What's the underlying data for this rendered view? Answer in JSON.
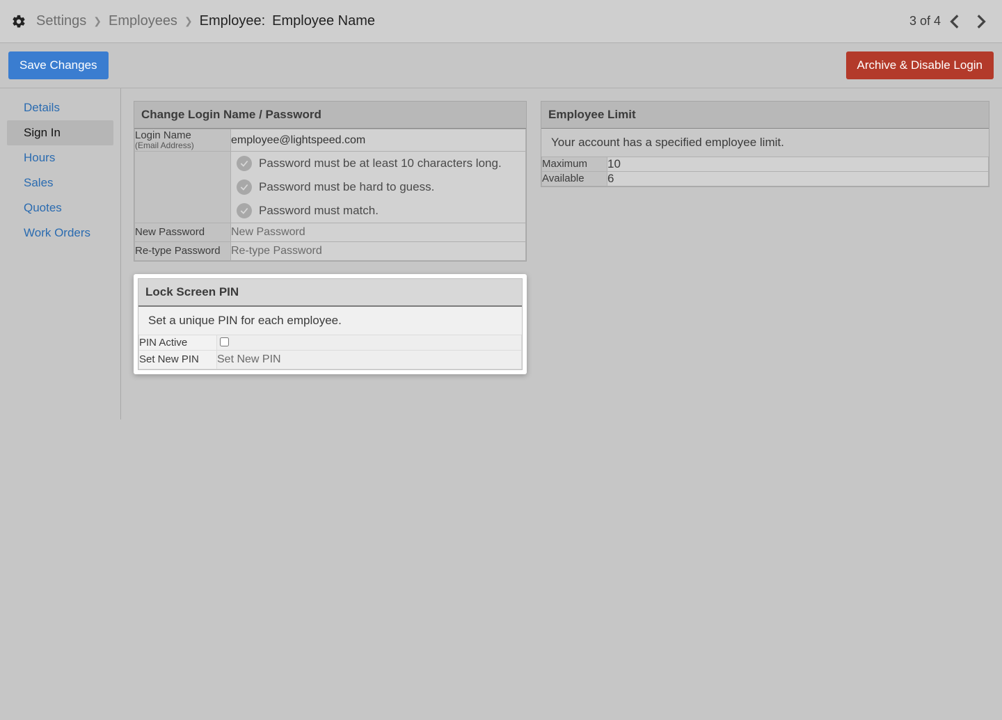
{
  "breadcrumb": {
    "root": "Settings",
    "section": "Employees",
    "page_label": "Employee:",
    "page_name": "Employee Name"
  },
  "pager": {
    "position": "3 of 4"
  },
  "actions": {
    "save": "Save Changes",
    "archive": "Archive & Disable Login"
  },
  "sidebar": {
    "items": [
      {
        "label": "Details",
        "active": false
      },
      {
        "label": "Sign In",
        "active": true
      },
      {
        "label": "Hours",
        "active": false
      },
      {
        "label": "Sales",
        "active": false
      },
      {
        "label": "Quotes",
        "active": false
      },
      {
        "label": "Work Orders",
        "active": false
      }
    ]
  },
  "login_panel": {
    "title": "Change Login Name / Password",
    "login_name_label": "Login Name",
    "login_name_sublabel": "(Email Address)",
    "login_name_value": "employee@lightspeed.com",
    "rules": [
      "Password must be at least 10 characters long.",
      "Password must be hard to guess.",
      "Password must match."
    ],
    "new_password_label": "New Password",
    "new_password_placeholder": "New Password",
    "retype_label": "Re-type Password",
    "retype_placeholder": "Re-type Password"
  },
  "pin_panel": {
    "title": "Lock Screen PIN",
    "note": "Set a unique PIN for each employee.",
    "pin_active_label": "PIN Active",
    "pin_active_checked": false,
    "set_pin_label": "Set New PIN",
    "set_pin_placeholder": "Set New PIN"
  },
  "limit_panel": {
    "title": "Employee Limit",
    "note": "Your account has a specified employee limit.",
    "rows": [
      {
        "label": "Maximum",
        "value": "10"
      },
      {
        "label": "Available",
        "value": "6"
      }
    ]
  }
}
